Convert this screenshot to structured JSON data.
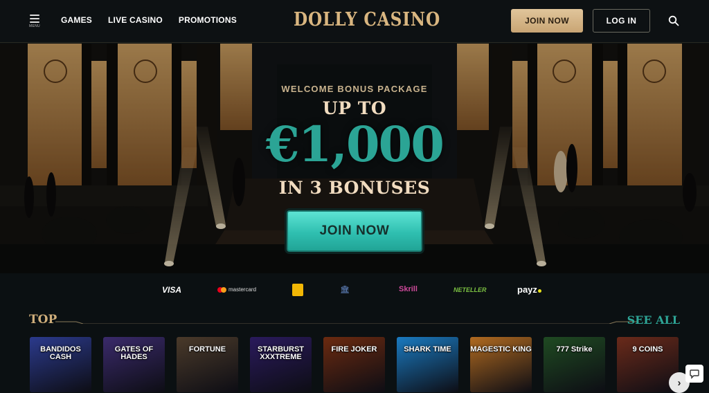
{
  "header": {
    "menu_label": "MENU",
    "nav": [
      "GAMES",
      "LIVE CASINO",
      "PROMOTIONS"
    ],
    "logo": "DOLLY CASINO",
    "join_label": "JOIN NOW",
    "login_label": "LOG IN"
  },
  "hero": {
    "eyebrow": "WELCOME BONUS PACKAGE",
    "up_to": "UP TO",
    "amount": "€1,000",
    "bonuses": "IN 3 BONUSES",
    "cta_label": "JOIN NOW"
  },
  "payments": [
    "VISA",
    "mastercard",
    "Paysafecard",
    "Bank Transfer",
    "Skrill",
    "NETELLER",
    "payz"
  ],
  "top_section": {
    "title": "TOP",
    "see_all": "SEE ALL"
  },
  "games": [
    {
      "name": "BANDIDOS CASH",
      "color": "#2b3a8c"
    },
    {
      "name": "GATES OF HADES",
      "color": "#3a2a6b"
    },
    {
      "name": "FORTUNE",
      "color": "#4a3a2a"
    },
    {
      "name": "STARBURST XXXTREME",
      "color": "#2a1a5c"
    },
    {
      "name": "FIRE JOKER",
      "color": "#6b2a10"
    },
    {
      "name": "SHARK TIME",
      "color": "#1a7ac0"
    },
    {
      "name": "MAGESTIC KING",
      "color": "#b06a20"
    },
    {
      "name": "777 Strike",
      "color": "#1f4a22"
    },
    {
      "name": "9 COINS",
      "color": "#6a2a1a"
    }
  ],
  "colors": {
    "gold": "#d9b680",
    "teal": "#2ba495",
    "background": "#0b1012"
  }
}
